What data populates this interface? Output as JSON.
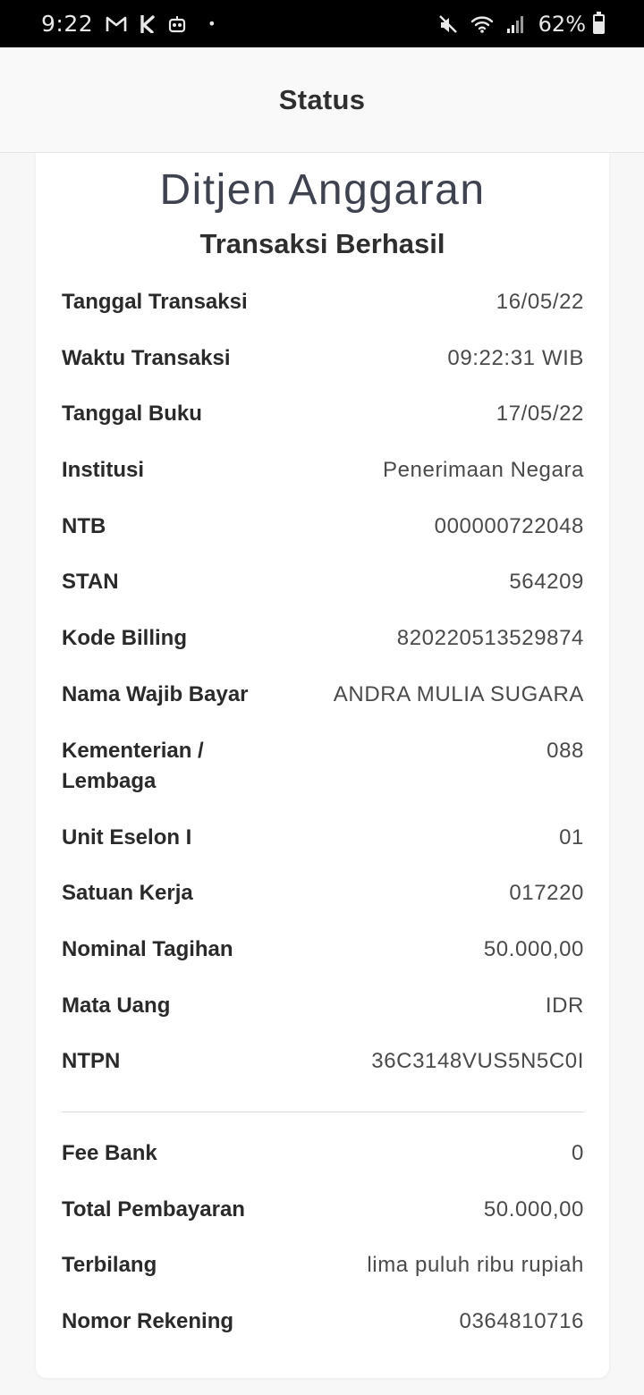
{
  "statusbar": {
    "time": "9:22",
    "battery": "62%",
    "battery_level": 0.62
  },
  "appbar": {
    "title": "Status"
  },
  "card": {
    "brand": "Ditjen Anggaran",
    "subtitle": "Transaksi Berhasil",
    "rows": [
      {
        "label": "Tanggal Transaksi",
        "value": "16/05/22"
      },
      {
        "label": "Waktu Transaksi",
        "value": "09:22:31 WIB"
      },
      {
        "label": "Tanggal Buku",
        "value": "17/05/22"
      },
      {
        "label": "Institusi",
        "value": "Penerimaan Negara"
      },
      {
        "label": "NTB",
        "value": "000000722048"
      },
      {
        "label": "STAN",
        "value": "564209"
      },
      {
        "label": "Kode Billing",
        "value": "820220513529874"
      },
      {
        "label": "Nama Wajib Bayar",
        "value": "ANDRA MULIA SUGARA"
      },
      {
        "label": "Kementerian / Lembaga",
        "value": "088"
      },
      {
        "label": "Unit Eselon I",
        "value": "01"
      },
      {
        "label": "Satuan Kerja",
        "value": "017220"
      },
      {
        "label": "Nominal Tagihan",
        "value": "50.000,00"
      },
      {
        "label": "Mata Uang",
        "value": "IDR"
      },
      {
        "label": "NTPN",
        "value": "36C3148VUS5N5C0I"
      }
    ],
    "summary": [
      {
        "label": "Fee Bank",
        "value": "0"
      },
      {
        "label": "Total Pembayaran",
        "value": "50.000,00"
      },
      {
        "label": "Terbilang",
        "value": "lima puluh ribu rupiah"
      },
      {
        "label": "Nomor Rekening",
        "value": "0364810716"
      }
    ]
  }
}
